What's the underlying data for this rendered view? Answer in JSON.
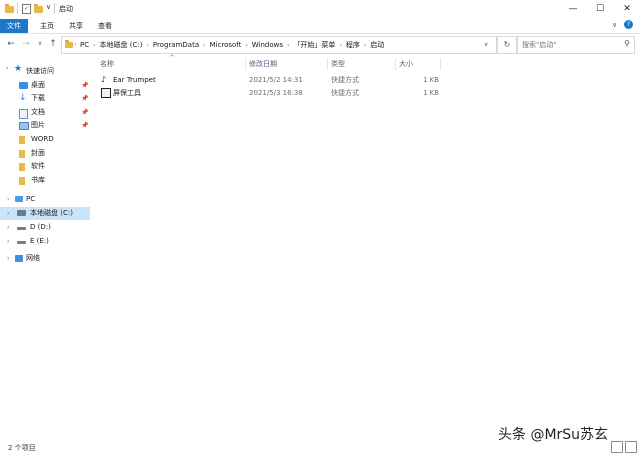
{
  "window": {
    "title": "启动",
    "controls": [
      "—",
      "☐",
      "✕"
    ]
  },
  "ribbon": {
    "tabs": [
      "文件",
      "主页",
      "共享",
      "查看"
    ]
  },
  "address_bar": {
    "crumbs": [
      "PC",
      "本地磁盘 (C:)",
      "ProgramData",
      "Microsoft",
      "Windows",
      "「开始」菜单",
      "程序",
      "启动"
    ]
  },
  "search": {
    "placeholder": "搜索\"启动\""
  },
  "sidebar": {
    "quick_access": "快速访问",
    "pinned": [
      {
        "label": "桌面",
        "icon": "desktop-icon"
      },
      {
        "label": "下载",
        "icon": "download-icon"
      },
      {
        "label": "文档",
        "icon": "document-icon"
      },
      {
        "label": "图片",
        "icon": "pictures-icon"
      }
    ],
    "folders": [
      "WORD",
      "封面",
      "软件",
      "书库"
    ],
    "pc": "PC",
    "drives": [
      "本地磁盘 (C:)",
      "D (D:)",
      "E (E:)"
    ],
    "network": "网络"
  },
  "columns": {
    "name": "名称",
    "modified": "修改日期",
    "type": "类型",
    "size": "大小"
  },
  "files": [
    {
      "name": "Ear Trumpet",
      "modified": "2021/5/2 14:31",
      "type": "快捷方式",
      "size": "1 KB",
      "icon": "ear-trumpet-icon"
    },
    {
      "name": "屏保工具",
      "modified": "2021/5/3 16:38",
      "type": "快捷方式",
      "size": "1 KB",
      "icon": "screensaver-tool-icon"
    }
  ],
  "status": {
    "item_count": "2 个项目"
  },
  "watermark": "头条 @MrSu苏玄",
  "colors": {
    "accent": "#1979ca",
    "selected": "#cce4f7",
    "folder": "#e8b84a"
  }
}
